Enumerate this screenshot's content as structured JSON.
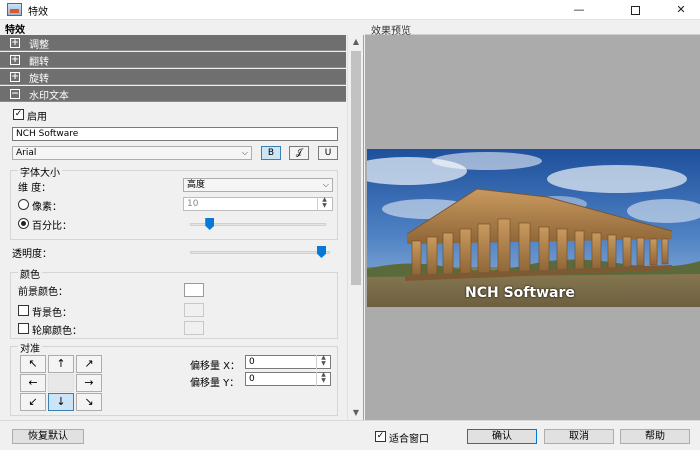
{
  "window": {
    "title": "特效",
    "min_glyph": "—",
    "close_glyph": "✕"
  },
  "left_panel": {
    "header": "特效",
    "accordion": [
      {
        "sign": "+",
        "label": "调整"
      },
      {
        "sign": "+",
        "label": "翻转"
      },
      {
        "sign": "+",
        "label": "旋转"
      },
      {
        "sign": "−",
        "label": "水印文本"
      }
    ],
    "enable": {
      "label": "启用",
      "checked": true
    },
    "watermark_text": "NCH Software",
    "font": {
      "family": "Arial",
      "bold_label": "B",
      "italic_label": "𝒥",
      "underline_label": "U"
    },
    "font_size": {
      "title": "字体大小",
      "dimension_label": "维 度：",
      "dimension_value": "高度",
      "pixels_label": "像素：",
      "pixels_value": "10",
      "percent_label": "百分比：",
      "selected": "percent",
      "percent_level": 0.12
    },
    "opacity": {
      "label": "透明度：",
      "level": 1.0
    },
    "color": {
      "title": "颜色",
      "foreground_label": "前景颜色：",
      "background_label": "背景色：",
      "outline_label": "轮廓颜色："
    },
    "align": {
      "title": "对准",
      "buttons": [
        "↖",
        "↑",
        "↗",
        "←",
        "",
        "→",
        "↙",
        "↓",
        "↘"
      ],
      "selected_index": 7,
      "offset_x_label": "偏移量 X：",
      "offset_x_value": "0",
      "offset_y_label": "偏移量 Y：",
      "offset_y_value": "0"
    }
  },
  "preview": {
    "header": "效果预览",
    "watermark": "NCH Software",
    "image_alt": "Greek temple ruins under blue sky"
  },
  "bottom": {
    "restore_default": "恢复默认",
    "fit_window": {
      "label": "适合窗口",
      "checked": true
    },
    "ok": "确认",
    "cancel": "取消",
    "help": "帮助"
  },
  "colors": {
    "accordion_bg": "#6f6f6f",
    "accent": "#0078d7",
    "preview_bg": "#ababab"
  }
}
